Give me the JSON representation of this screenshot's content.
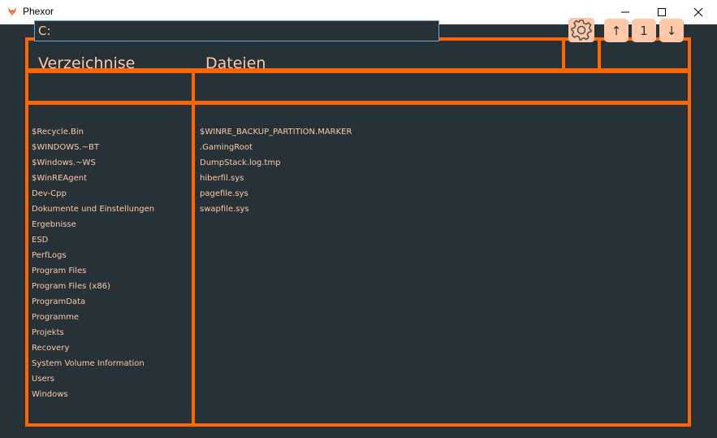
{
  "window": {
    "title": "Phexor",
    "minimize_icon": "minimize-icon",
    "maximize_icon": "maximize-icon",
    "close_icon": "close-icon"
  },
  "colors": {
    "background": "#263238",
    "border": "#ff6600",
    "text": "#ffc8a8",
    "button": "#ffc8a8"
  },
  "path": {
    "value": "C:"
  },
  "toolbar": {
    "settings_icon": "gear-icon",
    "up_label": "↑",
    "count_label": "1",
    "down_label": "↓"
  },
  "directories": {
    "header": "Verzeichnise",
    "items": [
      "$Recycle.Bin",
      "$WINDOWS.~BT",
      "$Windows.~WS",
      "$WinREAgent",
      "Dev-Cpp",
      "Dokumente und Einstellungen",
      "Ergebnisse",
      "ESD",
      "PerfLogs",
      "Program Files",
      "Program Files (x86)",
      "ProgramData",
      "Programme",
      "Projekts",
      "Recovery",
      "System Volume Information",
      "Users",
      "Windows"
    ]
  },
  "files": {
    "header": "Dateien",
    "items": [
      "$WINRE_BACKUP_PARTITION.MARKER",
      ".GamingRoot",
      "DumpStack.log.tmp",
      "hiberfil.sys",
      "pagefile.sys",
      "swapfile.sys"
    ]
  }
}
